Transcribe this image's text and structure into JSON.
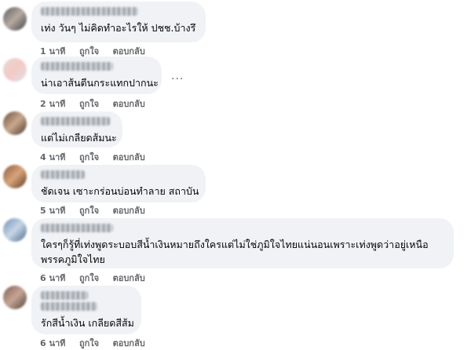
{
  "comments": [
    {
      "text": "เท่ง วันๆ ไม่คิดทำอะไรให้ ปชช.บ้างรึ",
      "time": "1 นาที"
    },
    {
      "text": "น่าเอาส้นตีนกระแทกปากนะ",
      "time": "2 นาที"
    },
    {
      "text": "แต่ไม่เกลียดส้มนะ",
      "time": "4 นาที"
    },
    {
      "text": "ชัดเจน เซาะกร่อนบ่อนทำลาย สถาบัน",
      "time": "5 นาที"
    },
    {
      "text_lines": [
        "ใครๆก็รู้ที่เท่งพูดระบอบสีน้ำเงินหมายถึงใครแต่ไม่ใช่ภูมิใจไทยแน่นอนเพราะเท่งพูดว่าอยู่เหนือ",
        "พรรคภูมิใจไทย"
      ],
      "time": "6 นาที"
    },
    {
      "text": "รักสีน้ำเงิน เกลียดสีส้ม",
      "time": "6 นาที"
    }
  ],
  "actions": {
    "like": "ถูกใจ",
    "reply": "ตอบกลับ"
  },
  "more_menu": "...",
  "colors": {
    "bubble": "#f0f2f5",
    "meta": "#65676b",
    "text": "#050505"
  },
  "icons": {
    "more": "more-options-icon"
  }
}
